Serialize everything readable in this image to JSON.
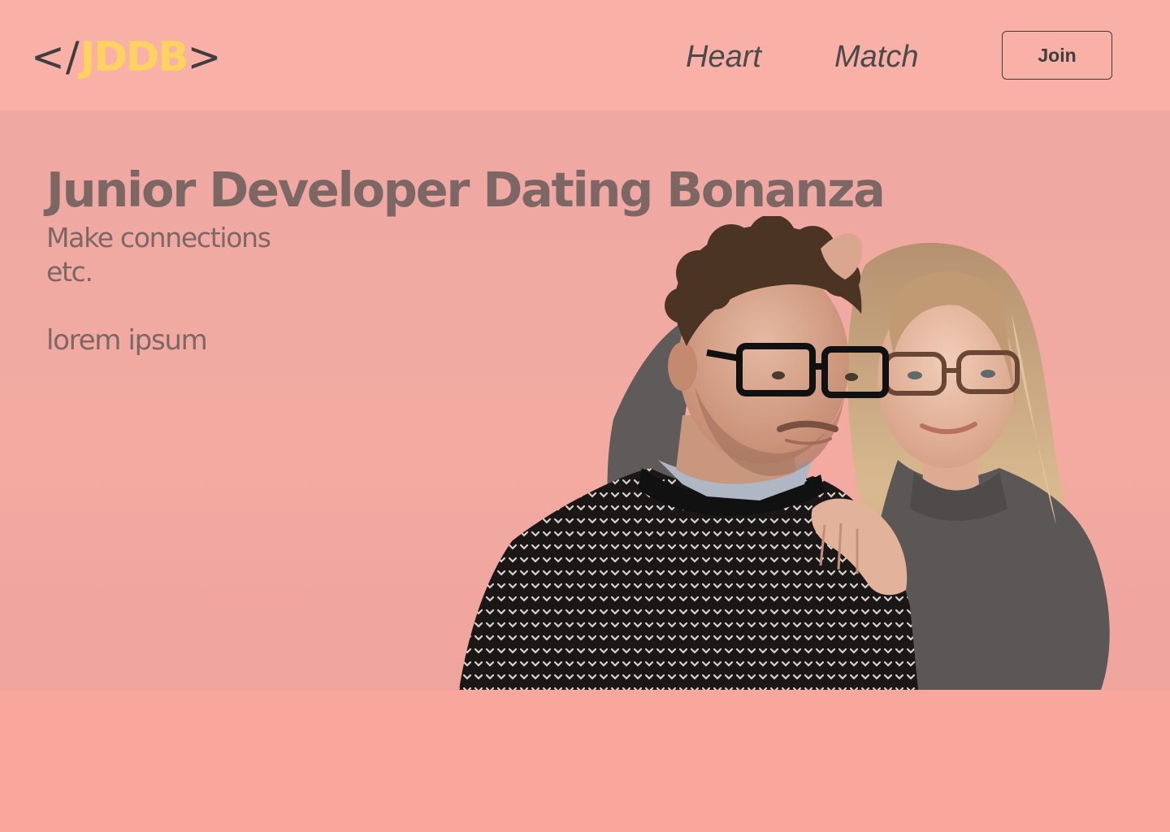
{
  "header": {
    "logo": {
      "open_bracket": "</",
      "letters": "JDDB",
      "close_bracket": ">",
      "letters_color": "#fcd35f",
      "bracket_color": "#3e3e3e"
    },
    "nav": {
      "heart_label": "Heart",
      "match_label": "Match"
    },
    "join_label": "Join"
  },
  "hero": {
    "title": "Junior Developer Dating Bonanza",
    "subtitle_line1": "Make connections",
    "subtitle_line2": "etc.",
    "tagline": "lorem ipsum",
    "image": "couple-photo"
  },
  "colors": {
    "header_bg": "#f8b0a7",
    "hero_bg": "#efa9a2",
    "footer_bg": "#f9a79d",
    "title_text": "#7d6764",
    "nav_text": "#4a4a4a"
  }
}
